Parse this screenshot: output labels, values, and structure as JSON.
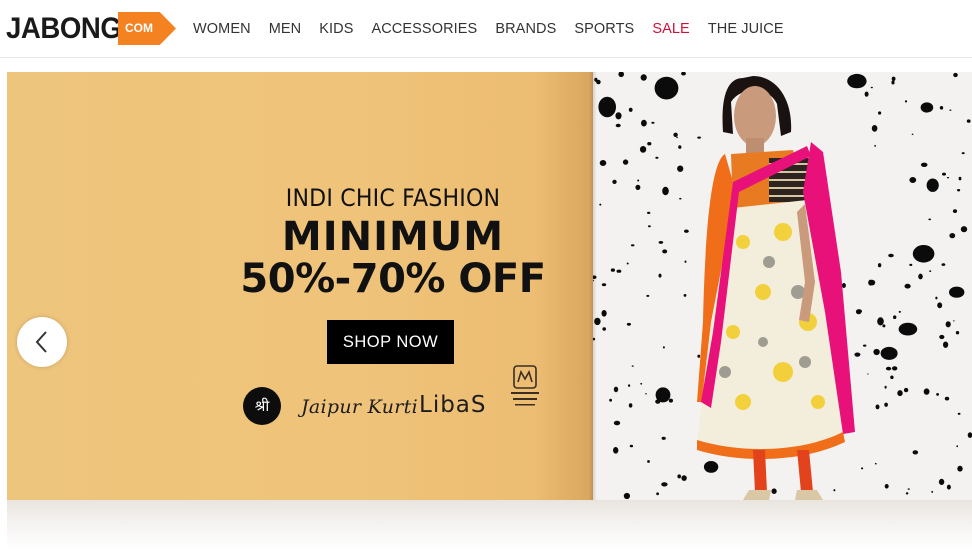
{
  "header": {
    "logo": {
      "word": "JABONG",
      "tag": "COM",
      "tag_color": "#f58220"
    },
    "nav": [
      {
        "label": "WOMEN"
      },
      {
        "label": "MEN"
      },
      {
        "label": "KIDS"
      },
      {
        "label": "ACCESSORIES"
      },
      {
        "label": "BRANDS"
      },
      {
        "label": "SPORTS"
      },
      {
        "label": "SALE",
        "color": "#d0103a"
      },
      {
        "label": "THE JUICE"
      }
    ]
  },
  "banner": {
    "line1": "INDI CHIC FASHION",
    "line2": "MINIMUM",
    "line3": "50%-70% OFF",
    "cta": "SHOP NOW",
    "brands": {
      "shree": "श्री",
      "jaipur": "Jaipur Kurti",
      "libas": "LibaS"
    },
    "prev_icon": "chevron-left-icon"
  }
}
